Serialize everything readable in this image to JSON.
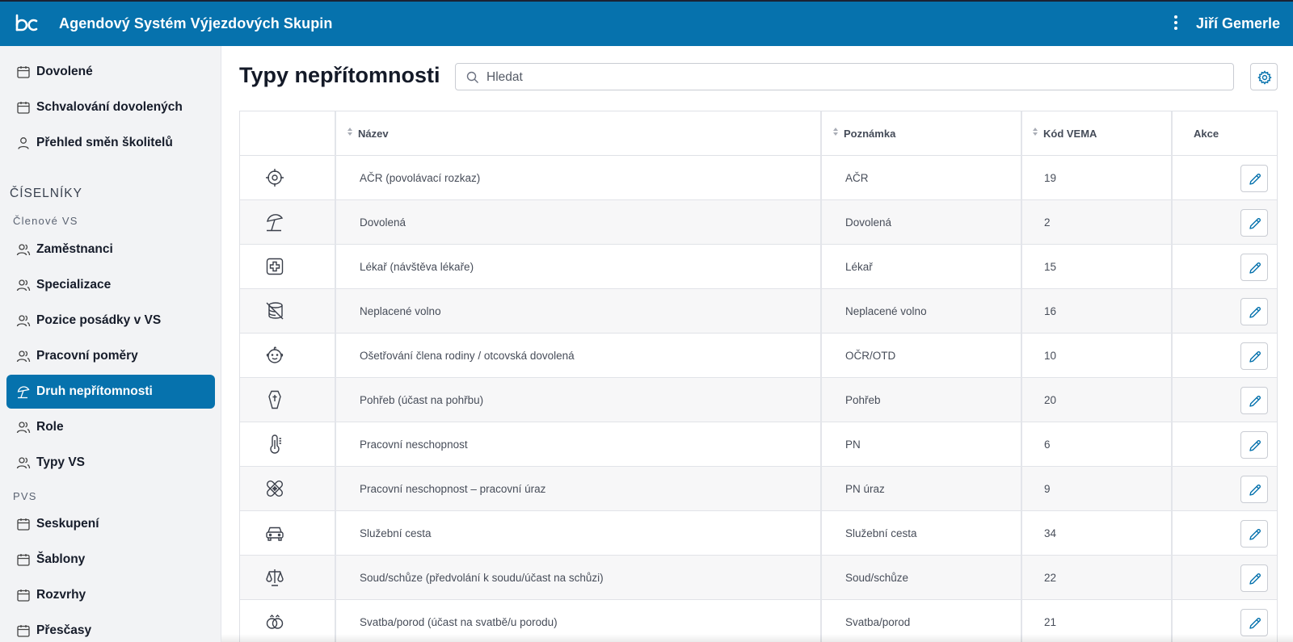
{
  "header": {
    "app_title": "Agendový Systém Výjezdových Skupin",
    "user_name": "Jiří Gemerle",
    "brand_color": "#0672ad"
  },
  "sidebar": {
    "top_items": [
      {
        "label": "Dovolené",
        "icon": "calendar-icon"
      },
      {
        "label": "Schvalování dovolených",
        "icon": "calendar-icon"
      },
      {
        "label": "Přehled směn školitelů",
        "icon": "user-icon"
      }
    ],
    "section_title": "ČÍSELNÍKY",
    "group1_title": "Členové VS",
    "group1_items": [
      {
        "label": "Zaměstnanci",
        "icon": "users-icon"
      },
      {
        "label": "Specializace",
        "icon": "users-icon"
      },
      {
        "label": "Pozice posádky v VS",
        "icon": "users-icon"
      },
      {
        "label": "Pracovní poměry",
        "icon": "users-icon"
      },
      {
        "label": "Druh nepřítomnosti",
        "icon": "beach-umbrella-icon",
        "active": true
      },
      {
        "label": "Role",
        "icon": "users-icon"
      },
      {
        "label": "Typy VS",
        "icon": "users-icon"
      }
    ],
    "group2_title": "PVS",
    "group2_items": [
      {
        "label": "Seskupení",
        "icon": "calendar-icon"
      },
      {
        "label": "Šablony",
        "icon": "calendar-icon"
      },
      {
        "label": "Rozvrhy",
        "icon": "calendar-icon"
      },
      {
        "label": "Přesčasy",
        "icon": "calendar-icon"
      }
    ]
  },
  "main": {
    "title": "Typy nepřítomnosti",
    "search_placeholder": "Hledat"
  },
  "table": {
    "columns": {
      "name": "Název",
      "note": "Poznámka",
      "code": "Kód VEMA",
      "actions": "Akce"
    },
    "rows": [
      {
        "icon": "target-icon",
        "name": "AČR (povolávací rozkaz)",
        "note": "AČR",
        "code": "19"
      },
      {
        "icon": "beach-umbrella-icon",
        "name": "Dovolená",
        "note": "Dovolená",
        "code": "2"
      },
      {
        "icon": "medical-cross-icon",
        "name": "Lékař (návštěva lékaře)",
        "note": "Lékař",
        "code": "15"
      },
      {
        "icon": "coins-crossed-icon",
        "name": "Neplacené volno",
        "note": "Neplacené volno",
        "code": "16"
      },
      {
        "icon": "baby-face-icon",
        "name": "Ošetřování člena rodiny / otcovská dovolená",
        "note": "OČR/OTD",
        "code": "10"
      },
      {
        "icon": "coffin-icon",
        "name": "Pohřeb (účast na pohřbu)",
        "note": "Pohřeb",
        "code": "20"
      },
      {
        "icon": "thermometer-icon",
        "name": "Pracovní neschopnost",
        "note": "PN",
        "code": "6"
      },
      {
        "icon": "bandage-icon",
        "name": "Pracovní neschopnost – pracovní úraz",
        "note": "PN úraz",
        "code": "9"
      },
      {
        "icon": "car-icon",
        "name": "Služební cesta",
        "note": "Služební cesta",
        "code": "34"
      },
      {
        "icon": "scales-icon",
        "name": "Soud/schůze (předvolání k soudu/účast na schůzi)",
        "note": "Soud/schůze",
        "code": "22"
      },
      {
        "icon": "rings-icon",
        "name": "Svatba/porod (účast na svatbě/u porodu)",
        "note": "Svatba/porod",
        "code": "21"
      }
    ]
  }
}
